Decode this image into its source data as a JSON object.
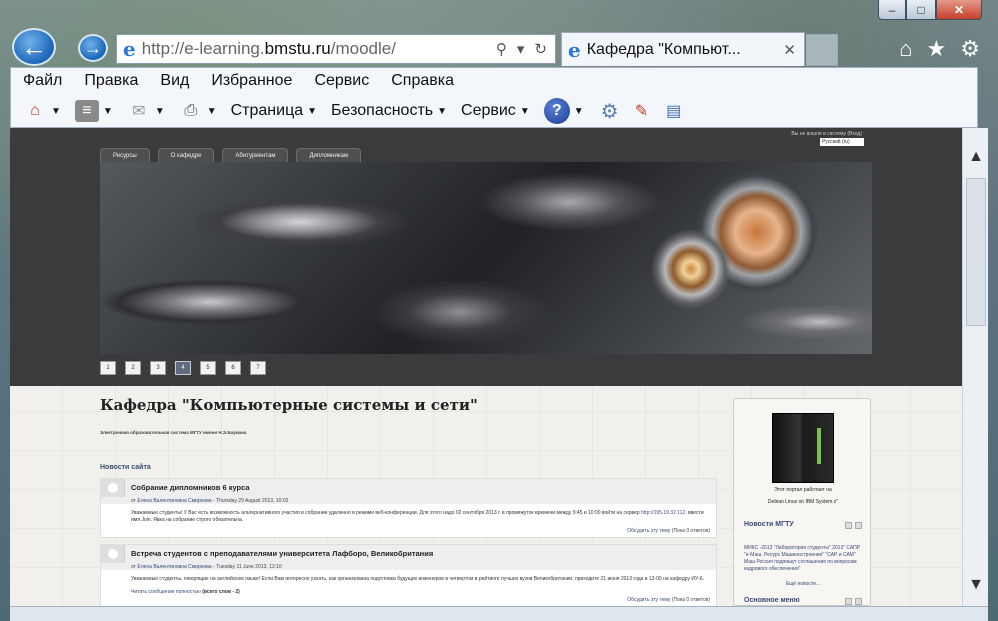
{
  "browser": {
    "address": {
      "prefix": "http://e-learning.",
      "domain": "bmstu.ru",
      "path": "/moodle/"
    },
    "tab_title": "Кафедра \"Компьют...",
    "menu": [
      "Файл",
      "Правка",
      "Вид",
      "Избранное",
      "Сервис",
      "Справка"
    ],
    "commands": {
      "page": "Страница",
      "security": "Безопасность",
      "service": "Сервис"
    }
  },
  "page": {
    "lang_hint": "Вы не вошли в систему (Вход)",
    "lang_select": "Русский (ru)",
    "top_tabs": [
      "Ресурсы",
      "О кафедре",
      "Абитуриентам",
      "Дипломникам"
    ],
    "slider_pages": [
      "1",
      "2",
      "3",
      "4",
      "5",
      "6",
      "7"
    ],
    "slider_active": "4",
    "title": "Кафедра \"Компьютерные системы и сети\"",
    "subtitle": "Электронная образовательная система МГТУ имени Н.Э.Баумана",
    "news_heading": "Новости сайта",
    "posts": [
      {
        "title": "Собрание дипломников 6 курса",
        "by": "от",
        "author": "Елена Валентиновна Смирнова",
        "date": " - Thursday 29 August 2013, 10:02",
        "body": "Уважаемые студенты! У Вас есть возможность альтернативного участия в собрании удаленно в режиме веб-конференции. Для этого надо 02 сентября 2013 г. в промежуток времени между 9:45 и 10:00 войти на сервер",
        "link": "http://195.19.32.112",
        "body_tail": ", ввести имя Join.  Явка на собрание строго обязательна.",
        "discuss": "Обсудить эту тему",
        "replies": " (Пока 0 ответов)"
      },
      {
        "title": "Встреча студентов с преподавателями университета Лафборо, Великобритания",
        "by": "от",
        "author": "Елена Валентиновна Смирнова",
        "date": " - Tuesday 11 June 2013, 12:10",
        "body": "Уважаемые студенты, говорящие на английском языке! Если Вам интересно узнать, как организована подготовка будущих инженеров в четвертом в рейтинге лучших вузов Великобритании, приходите 21 июня 2013 года в 13-00 на кафедру ИУ-6.",
        "read_more": "Читать сообщение полностью",
        "read_more_count": " (всего слов - 2)",
        "discuss": "Обсудить эту тему",
        "replies": " (Пока 0 ответов)"
      }
    ],
    "sidebar": {
      "server_caption_1": "Этот портал работает на",
      "server_caption_2": "Debian Linux on IBM System z\"",
      "news_title": "Новости МГТУ",
      "news_text": "МИКС -2013 \"Лаборатория студенты\" 2013\" САПР \"e-Маш. Ресурс Машиностроения\" \"САР и САМ\" Маш Россия подпишут соглашения по вопросам кадрового обеспечения\"",
      "more": "Ещё новости...",
      "menu_title": "Основное меню"
    }
  }
}
